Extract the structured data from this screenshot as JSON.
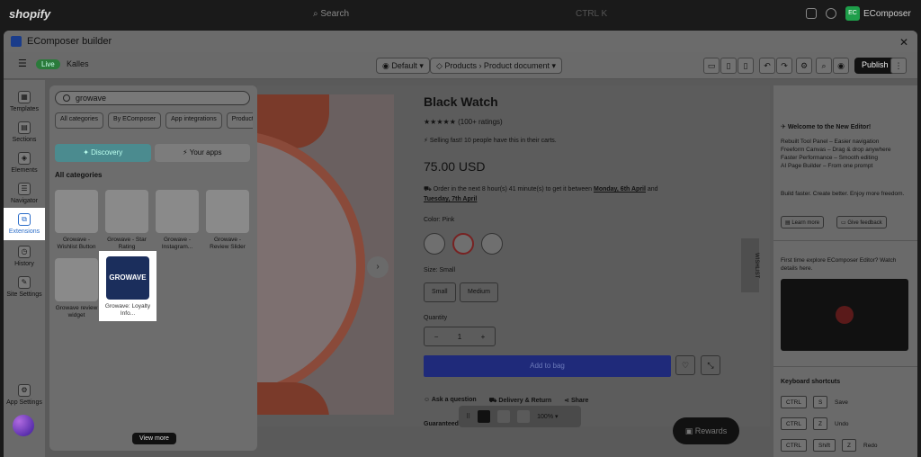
{
  "topbar": {
    "logo": "shopify",
    "search": "Search",
    "shortcut": "CTRL K",
    "store_badge": "EC",
    "store_name": "EComposer"
  },
  "app": {
    "title": "EComposer builder",
    "close": "✕"
  },
  "toolbar": {
    "menu": "☰",
    "live": "Live",
    "store": "Kalles",
    "template_default": "Default",
    "page_select": "Products › Product document",
    "publish": "Publish",
    "more": "⋮"
  },
  "leftnav": {
    "items": [
      {
        "label": "Templates",
        "icon": "templates-icon",
        "glyph": "▦"
      },
      {
        "label": "Sections",
        "icon": "sections-icon",
        "glyph": "▤"
      },
      {
        "label": "Elements",
        "icon": "elements-icon",
        "glyph": "◈"
      },
      {
        "label": "Navigator",
        "icon": "navigator-icon",
        "glyph": "☰"
      },
      {
        "label": "Extensions",
        "icon": "extensions-icon",
        "glyph": "⧉"
      },
      {
        "label": "History",
        "icon": "history-icon",
        "glyph": "◷"
      },
      {
        "label": "Site Settings",
        "icon": "site-settings-icon",
        "glyph": "✎"
      },
      {
        "label": "App Settings",
        "icon": "gear-icon",
        "glyph": "⚙"
      }
    ]
  },
  "extensions": {
    "search_value": "growave",
    "categories": [
      "All categories",
      "By EComposer",
      "App integrations",
      "Product"
    ],
    "tabs": [
      {
        "label": "Discovery",
        "icon": "compass-icon"
      },
      {
        "label": "Your apps",
        "icon": "bolt-icon"
      }
    ],
    "section_title": "All categories",
    "cards": [
      {
        "title": "Growave - Wishlist Button"
      },
      {
        "title": "Growave - Star Rating"
      },
      {
        "title": "Growave - Instagram..."
      },
      {
        "title": "Growave - Review Slider"
      },
      {
        "title": "Growave review widget"
      },
      {
        "title": "Growave: Loyalty Info...",
        "logo": "GROWAVE"
      }
    ],
    "view_more": "View more"
  },
  "product": {
    "title": "Black Watch",
    "stars": "★★★★★",
    "rating": "(100+ ratings)",
    "selling": "Selling fast! 10 people have this in their carts.",
    "price": "75.00 USD",
    "order_prefix": "Order in the next 8 hour(s) 41 minute(s) to get it between",
    "date_from": "Monday, 6th April",
    "order_mid": "and",
    "date_to": "Tuesday, 7th April",
    "color_label": "Color: Pink",
    "size_label": "Size: Small",
    "sizes": [
      "Small",
      "Medium"
    ],
    "quantity_label": "Quantity",
    "qty_minus": "−",
    "qty_value": "1",
    "qty_plus": "+",
    "add_to_bag": "Add to bag",
    "links": [
      "Ask a question",
      "Delivery & Return",
      "Share"
    ],
    "guarantee": "Guaranteed Checkout",
    "wishlist_tab": "WISHLIST",
    "zoom": "100%",
    "rewards": "Rewards"
  },
  "rightpanel": {
    "welcome": "Welcome to the New Editor!",
    "bullets": [
      "Rebuilt Tool Panel – Easier navigation",
      "Freeform Canvas – Drag & drop anywhere",
      "Faster Performance – Smooth editing",
      "AI Page Builder – From one prompt"
    ],
    "tagline": "Build faster. Create better. Enjoy more freedom.",
    "learn_more": "Learn more",
    "feedback": "Give feedback",
    "explore": "First time explore EComposer Editor? Watch details here.",
    "shortcuts_title": "Keyboard shortcuts",
    "shortcuts": [
      {
        "keys": [
          "CTRL",
          "S"
        ],
        "label": "Save"
      },
      {
        "keys": [
          "CTRL",
          "Z"
        ],
        "label": "Undo"
      },
      {
        "keys": [
          "CTRL",
          "Shift",
          "Z"
        ],
        "label": "Redo"
      }
    ]
  }
}
